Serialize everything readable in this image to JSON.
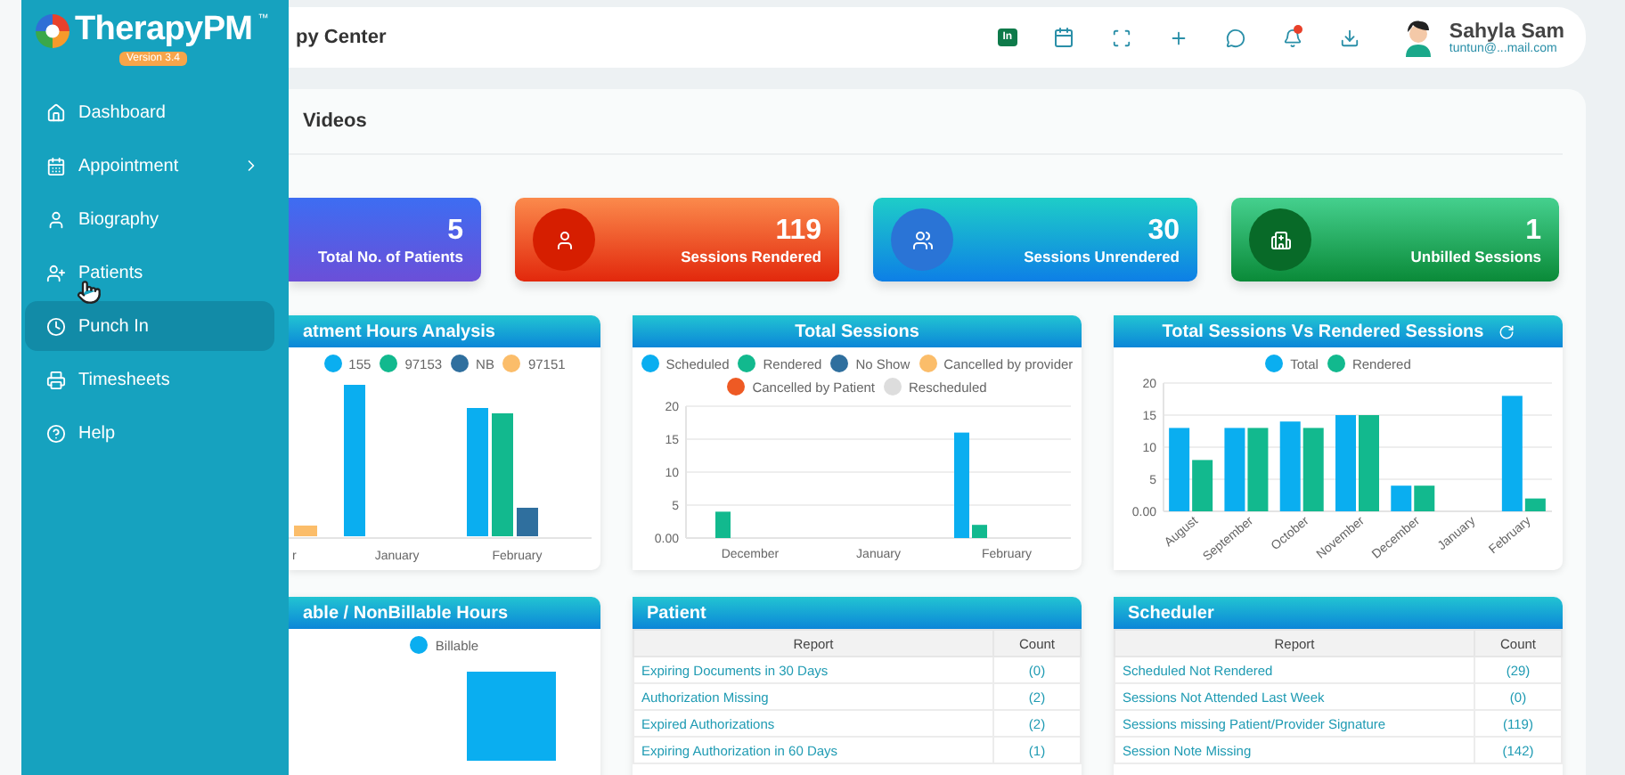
{
  "sidebar": {
    "logo": {
      "name": "TherapyPM",
      "mark": "™",
      "version": "Version 3.4"
    },
    "items": [
      {
        "label": "Dashboard",
        "selected": false,
        "expandable": false
      },
      {
        "label": "Appointment",
        "selected": false,
        "expandable": true
      },
      {
        "label": "Biography",
        "selected": false,
        "expandable": false
      },
      {
        "label": "Patients",
        "selected": false,
        "expandable": false
      },
      {
        "label": "Punch In",
        "selected": true,
        "expandable": false
      },
      {
        "label": "Timesheets",
        "selected": false,
        "expandable": false
      },
      {
        "label": "Help",
        "selected": false,
        "expandable": false
      }
    ]
  },
  "header": {
    "title": "py Center",
    "punch_badge": "In",
    "notification_unread": true,
    "user": {
      "name": "Sahyla Sam",
      "email": "tuntun@...mail.com"
    }
  },
  "section_title": "Videos",
  "stat_cards": [
    {
      "kind": "patients",
      "value": "5",
      "label": "Total No. of Patients"
    },
    {
      "kind": "rendered",
      "value": "119",
      "label": "Sessions Rendered"
    },
    {
      "kind": "unrendered",
      "value": "30",
      "label": "Sessions Unrendered"
    },
    {
      "kind": "unbilled",
      "value": "1",
      "label": "Unbilled Sessions"
    }
  ],
  "treatment_hours": {
    "title": "atment Hours Analysis",
    "legend": [
      {
        "label": "155",
        "color": "#0aaef0"
      },
      {
        "label": "97153",
        "color": "#12b98e"
      },
      {
        "label": "NB",
        "color": "#2f6f9e"
      },
      {
        "label": "97151",
        "color": "#fbbd6a"
      }
    ],
    "x_labels": [
      "r",
      "January",
      "February"
    ]
  },
  "total_sessions": {
    "title": "Total Sessions",
    "chart_data": {
      "type": "bar",
      "grid": true,
      "categories": [
        "December",
        "January",
        "February"
      ],
      "ylim": [
        0,
        20
      ],
      "yticks": [
        {
          "value": 0,
          "label": "0.00"
        },
        5,
        10,
        15,
        20
      ],
      "series": [
        {
          "name": "Scheduled",
          "color": "#0aaef0",
          "values": [
            0,
            0,
            16
          ]
        },
        {
          "name": "Rendered",
          "color": "#12b98e",
          "values": [
            4,
            0,
            2
          ]
        },
        {
          "name": "No Show",
          "color": "#2f6f9e",
          "values": [
            0,
            0,
            0
          ]
        },
        {
          "name": "Cancelled by provider",
          "color": "#fbbd6a",
          "values": [
            0,
            0,
            0
          ]
        },
        {
          "name": "Cancelled by Patient",
          "color": "#ee5a24",
          "values": [
            0,
            0,
            0
          ]
        },
        {
          "name": "Rescheduled",
          "color": "#dddddd",
          "values": [
            0,
            0,
            0
          ]
        }
      ]
    }
  },
  "sessions_vs_rendered": {
    "title": "Total Sessions Vs Rendered Sessions",
    "chart_data": {
      "type": "bar",
      "grid": true,
      "categories": [
        "August",
        "September",
        "October",
        "November",
        "December",
        "January",
        "February"
      ],
      "ylim": [
        0,
        20
      ],
      "yticks": [
        {
          "value": 0,
          "label": "0.00"
        },
        5,
        10,
        15,
        20
      ],
      "series": [
        {
          "name": "Total",
          "color": "#0aaef0",
          "values": [
            13,
            13,
            14,
            15,
            4,
            0,
            18
          ]
        },
        {
          "name": "Rendered",
          "color": "#12b98e",
          "values": [
            8,
            13,
            13,
            15,
            4,
            0,
            2
          ]
        }
      ]
    }
  },
  "billable_hours": {
    "title": "able / NonBillable Hours",
    "legend": [
      {
        "label": "Billable",
        "color": "#0aaef0"
      }
    ]
  },
  "patient_report": {
    "title": "Patient",
    "columns": [
      "Report",
      "Count"
    ],
    "rows": [
      {
        "report": "Expiring Documents in 30 Days",
        "count": "(0)"
      },
      {
        "report": "Authorization Missing",
        "count": "(2)"
      },
      {
        "report": "Expired Authorizations",
        "count": "(2)"
      },
      {
        "report": "Expiring Authorization in 60 Days",
        "count": "(1)"
      }
    ]
  },
  "scheduler_report": {
    "title": "Scheduler",
    "columns": [
      "Report",
      "Count"
    ],
    "rows": [
      {
        "report": "Scheduled Not Rendered",
        "count": "(29)"
      },
      {
        "report": "Sessions Not Attended Last Week",
        "count": "(0)"
      },
      {
        "report": "Sessions missing Patient/Provider Signature",
        "count": "(119)"
      },
      {
        "report": "Session Note Missing",
        "count": "(142)"
      }
    ]
  }
}
